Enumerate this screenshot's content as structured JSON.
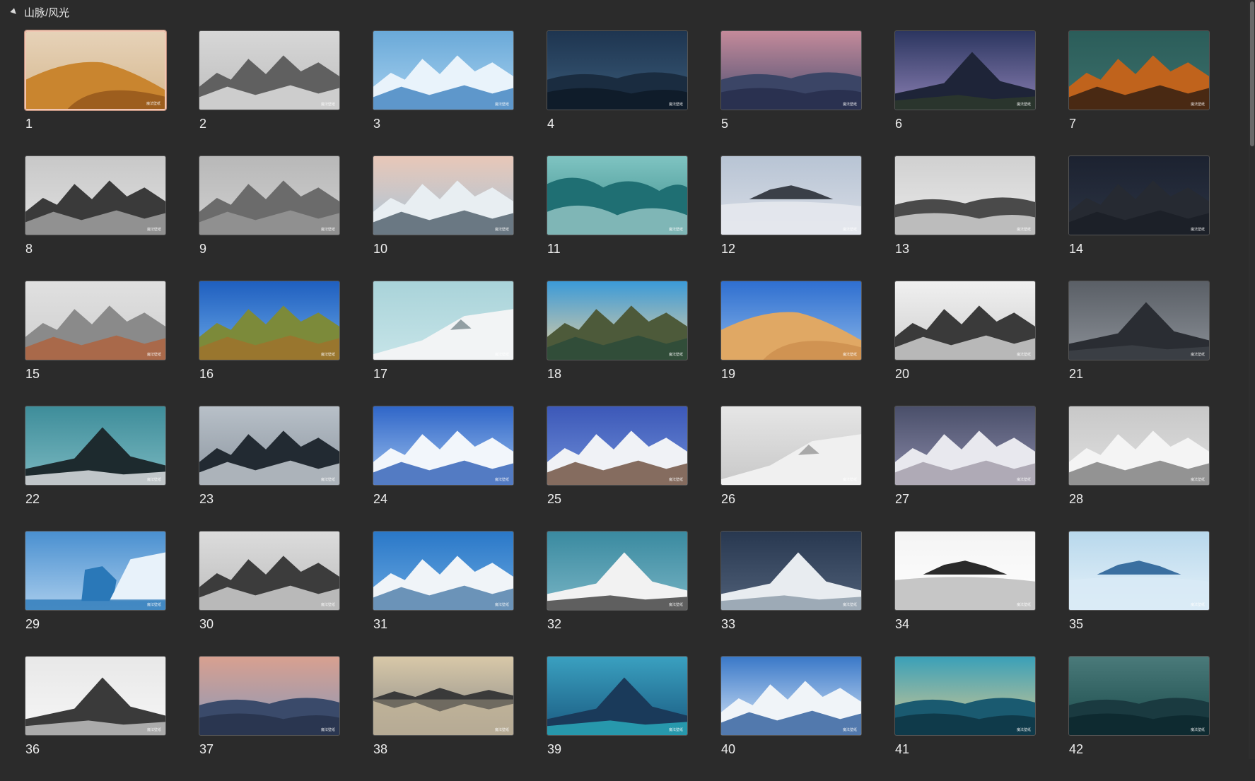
{
  "group": {
    "title": "山脉/风光",
    "expand_icon": "collapse-triangle-icon"
  },
  "watermark": "魔法壁纸",
  "selected_index": 0,
  "items": [
    {
      "label": "1",
      "sky": "#e6d2b8",
      "sky2": "#d6b88f",
      "land": "#c9852f",
      "land2": "#8a4d17",
      "kind": "dune"
    },
    {
      "label": "2",
      "sky": "#d7d7d7",
      "sky2": "#bdbdbd",
      "land": "#606060",
      "land2": "#e8e8e8",
      "kind": "peaks"
    },
    {
      "label": "3",
      "sky": "#6aa9d8",
      "sky2": "#a8d2f0",
      "land": "#e9f3fb",
      "land2": "#3b7fbf",
      "kind": "peaks"
    },
    {
      "label": "4",
      "sky": "#1e3550",
      "sky2": "#3b5c7a",
      "land": "#1a2c40",
      "land2": "#0f1c2a",
      "kind": "hills"
    },
    {
      "label": "5",
      "sky": "#c48a9a",
      "sky2": "#4a4f72",
      "land": "#3b4566",
      "land2": "#2a3150",
      "kind": "hills"
    },
    {
      "label": "6",
      "sky": "#2c3660",
      "sky2": "#8a7fb2",
      "land": "#1e2438",
      "land2": "#2d3a2a",
      "kind": "peak"
    },
    {
      "label": "7",
      "sky": "#2b5d5a",
      "sky2": "#3c6f6a",
      "land": "#c0631c",
      "land2": "#2a1a12",
      "kind": "peaks"
    },
    {
      "label": "8",
      "sky": "#c8c8c8",
      "sky2": "#e0e0e0",
      "land": "#3a3a3a",
      "land2": "#a8a8a8",
      "kind": "peaks"
    },
    {
      "label": "9",
      "sky": "#b8b8b8",
      "sky2": "#d0d0d0",
      "land": "#6b6b6b",
      "land2": "#9a9a9a",
      "kind": "peaks"
    },
    {
      "label": "10",
      "sky": "#e8c7b8",
      "sky2": "#a9c6d9",
      "land": "#e8eef2",
      "land2": "#4a5a66",
      "kind": "peaks"
    },
    {
      "label": "11",
      "sky": "#7fc4c2",
      "sky2": "#3a8a88",
      "land": "#1f6f73",
      "land2": "#bfe6e2",
      "kind": "waves"
    },
    {
      "label": "12",
      "sky": "#b8c4d4",
      "sky2": "#d8dde6",
      "land": "#3a3f48",
      "land2": "#e6e9ee",
      "kind": "island"
    },
    {
      "label": "13",
      "sky": "#d0d0d0",
      "sky2": "#eaeaea",
      "land": "#4a4a4a",
      "land2": "#bcbcbc",
      "kind": "hills"
    },
    {
      "label": "14",
      "sky": "#1c2230",
      "sky2": "#2c3444",
      "land": "#262a32",
      "land2": "#1a1e26",
      "kind": "peaks"
    },
    {
      "label": "15",
      "sky": "#e0e0e0",
      "sky2": "#cfcfcf",
      "land": "#8a8a8a",
      "land2": "#b0603a",
      "kind": "peaks"
    },
    {
      "label": "16",
      "sky": "#1f5fbf",
      "sky2": "#6aa8e8",
      "land": "#7c8a3a",
      "land2": "#a0702c",
      "kind": "peaks"
    },
    {
      "label": "17",
      "sky": "#a9d3d9",
      "sky2": "#c6e4e8",
      "land": "#f2f4f5",
      "land2": "#6a7a80",
      "kind": "slope"
    },
    {
      "label": "18",
      "sky": "#3b9ad8",
      "sky2": "#e8d0a0",
      "land": "#4d5a3a",
      "land2": "#2a4a3a",
      "kind": "peaks"
    },
    {
      "label": "19",
      "sky": "#2f6fd0",
      "sky2": "#8ab6e8",
      "land": "#e0a864",
      "land2": "#c98a4a",
      "kind": "dune"
    },
    {
      "label": "20",
      "sky": "#f0f0f0",
      "sky2": "#cfcfcf",
      "land": "#3a3a3a",
      "land2": "#d8d8d8",
      "kind": "peaks"
    },
    {
      "label": "21",
      "sky": "#5a5f66",
      "sky2": "#8a8f96",
      "land": "#2a2d33",
      "land2": "#3e4248",
      "kind": "peak"
    },
    {
      "label": "22",
      "sky": "#3e8d9a",
      "sky2": "#7ab8c0",
      "land": "#1d2a2e",
      "land2": "#eaeef0",
      "kind": "peak"
    },
    {
      "label": "23",
      "sky": "#b8c0c8",
      "sky2": "#8c96a0",
      "land": "#222a32",
      "land2": "#cfd6dc",
      "kind": "peaks"
    },
    {
      "label": "24",
      "sky": "#2f66c8",
      "sky2": "#9ec2ee",
      "land": "#f2f6fb",
      "land2": "#2a5cb5",
      "kind": "peaks"
    },
    {
      "label": "25",
      "sky": "#3c58b8",
      "sky2": "#6f8fd8",
      "land": "#f0f2f6",
      "land2": "#6a4a3a",
      "kind": "peaks"
    },
    {
      "label": "26",
      "sky": "#e6e6e6",
      "sky2": "#c8c8c8",
      "land": "#f0f0f0",
      "land2": "#8a8a8a",
      "kind": "slope"
    },
    {
      "label": "27",
      "sky": "#4a4f6a",
      "sky2": "#8a8aa8",
      "land": "#e8e8ee",
      "land2": "#a09aa8",
      "kind": "peaks"
    },
    {
      "label": "28",
      "sky": "#c8c8c8",
      "sky2": "#e0e0e0",
      "land": "#f4f4f4",
      "land2": "#7a7a7a",
      "kind": "peaks"
    },
    {
      "label": "29",
      "sky": "#4a90d0",
      "sky2": "#a8ccec",
      "land": "#e8f2fa",
      "land2": "#2a78b8",
      "kind": "iceberg"
    },
    {
      "label": "30",
      "sky": "#dcdcdc",
      "sky2": "#bcbcbc",
      "land": "#3c3c3c",
      "land2": "#d8d8d8",
      "kind": "peaks"
    },
    {
      "label": "31",
      "sky": "#2a78c8",
      "sky2": "#6aa8e0",
      "land": "#f0f4f8",
      "land2": "#4a7aa8",
      "kind": "peaks"
    },
    {
      "label": "32",
      "sky": "#3a8aa0",
      "sky2": "#78b4c4",
      "land": "#f2f2f2",
      "land2": "#3a3a3a",
      "kind": "peak"
    },
    {
      "label": "33",
      "sky": "#283850",
      "sky2": "#506078",
      "land": "#e8ecf0",
      "land2": "#8a9aa8",
      "kind": "peak"
    },
    {
      "label": "34",
      "sky": "#f4f4f4",
      "sky2": "#ffffff",
      "land": "#2a2a2a",
      "land2": "#bcbcbc",
      "kind": "island"
    },
    {
      "label": "35",
      "sky": "#b8d8ec",
      "sky2": "#e6f2fa",
      "land": "#3a6fa0",
      "land2": "#d8eaf6",
      "kind": "island"
    },
    {
      "label": "36",
      "sky": "#e8e8e8",
      "sky2": "#f6f6f6",
      "land": "#3a3a3a",
      "land2": "#c8c8c8",
      "kind": "peak"
    },
    {
      "label": "37",
      "sky": "#d8a090",
      "sky2": "#8a98b8",
      "land": "#3a4a6a",
      "land2": "#2a3650",
      "kind": "hills"
    },
    {
      "label": "38",
      "sky": "#d8c8a8",
      "sky2": "#8a8a88",
      "land": "#3a3a3a",
      "land2": "#c8b89a",
      "kind": "reflect"
    },
    {
      "label": "39",
      "sky": "#3aa0c0",
      "sky2": "#1a5a80",
      "land": "#1a3a5a",
      "land2": "#2ab0c0",
      "kind": "peak"
    },
    {
      "label": "40",
      "sky": "#3a78c8",
      "sky2": "#d8e8f8",
      "land": "#f0f4f8",
      "land2": "#2a5a9a",
      "kind": "peaks"
    },
    {
      "label": "41",
      "sky": "#3aa0b8",
      "sky2": "#d8c890",
      "land": "#1a5a70",
      "land2": "#0f3a4a",
      "kind": "hills"
    },
    {
      "label": "42",
      "sky": "#4a7a7a",
      "sky2": "#1a4a4a",
      "land": "#1a3a40",
      "land2": "#0e2a30",
      "kind": "hills"
    }
  ]
}
